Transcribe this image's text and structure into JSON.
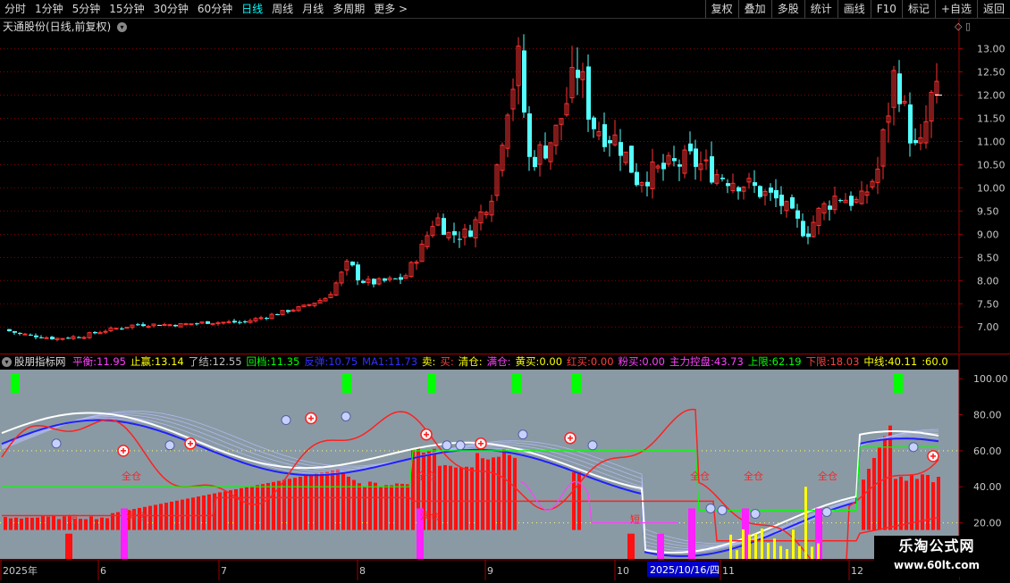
{
  "toolbar": {
    "periods": [
      "分时",
      "1分钟",
      "5分钟",
      "15分钟",
      "30分钟",
      "60分钟",
      "日线",
      "周线",
      "月线",
      "多周期",
      "更多 >"
    ],
    "active_period": "日线",
    "right_buttons": [
      "复权",
      "叠加",
      "多股",
      "统计",
      "画线",
      "F10",
      "标记",
      "+自选",
      "返回"
    ]
  },
  "price_panel": {
    "title": "天通股份(日线,前复权)",
    "menu_icon": "chevron-down-icon",
    "y_ticks": [
      "13.00",
      "12.50",
      "12.00",
      "11.50",
      "11.00",
      "10.50",
      "10.00",
      "9.50",
      "9.00",
      "8.50",
      "8.00",
      "7.50",
      "7.00"
    ],
    "y_range": [
      6.6,
      13.3
    ],
    "colors": {
      "up": "#ff3232",
      "down": "#54ffff",
      "grid": "#8b0000"
    }
  },
  "indicator_panel": {
    "name": "股朋指标网",
    "legend": [
      {
        "label": "平衡:",
        "value": "11.95",
        "color": "#ff40ff"
      },
      {
        "label": "止赢:",
        "value": "13.14",
        "color": "#ffff00"
      },
      {
        "label": "了结:",
        "value": "12.55",
        "color": "#c0c0c0"
      },
      {
        "label": "回档:",
        "value": "11.35",
        "color": "#00ff00"
      },
      {
        "label": "反弹:",
        "value": "10.75",
        "color": "#3030ff"
      },
      {
        "label": "MA1:",
        "value": "11.73",
        "color": "#3030ff"
      },
      {
        "label": "卖:",
        "value": "",
        "color": "#ffff00"
      },
      {
        "label": "买:",
        "value": "",
        "color": "#ff4040"
      },
      {
        "label": "清仓:",
        "value": "",
        "color": "#ffff00"
      },
      {
        "label": "满仓:",
        "value": "",
        "color": "#ff40ff"
      },
      {
        "label": "黄买:",
        "value": "0.00",
        "color": "#ffff00"
      },
      {
        "label": "红买:",
        "value": "0.00",
        "color": "#ff4040"
      },
      {
        "label": "粉买:",
        "value": "0.00",
        "color": "#ff40ff"
      },
      {
        "label": "主力控盘:",
        "value": "43.73",
        "color": "#ff40ff"
      },
      {
        "label": "上限:",
        "value": "62.19",
        "color": "#00ff00"
      },
      {
        "label": "下限:",
        "value": "18.03",
        "color": "#ff4040"
      },
      {
        "label": "中线:",
        "value": "40.11",
        "color": "#ffff00"
      },
      {
        "label": ":",
        "value": "60.0",
        "color": "#ffff00"
      }
    ],
    "y_ticks": [
      "100.00",
      "80.00",
      "60.00",
      "40.00",
      "20.00"
    ],
    "markers": {
      "full": "全仓",
      "full2": "满仓",
      "short": "短"
    }
  },
  "x_axis": {
    "labels": [
      "2025年",
      "6",
      "7",
      "8",
      "9",
      "10",
      "11",
      "12"
    ],
    "cursor_date": "2025/10/16/四"
  },
  "watermark": {
    "line1": "乐淘公式网",
    "line2": "www.60lt.com"
  }
}
